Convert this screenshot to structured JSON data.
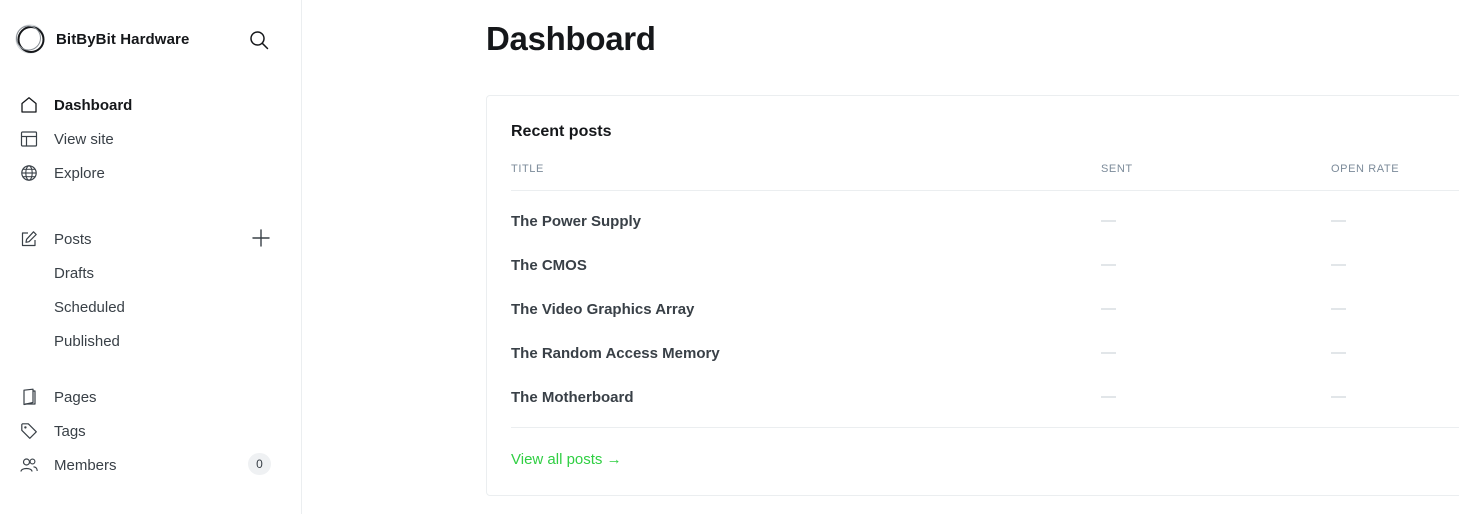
{
  "brand": {
    "name": "BitByBit Hardware"
  },
  "nav": {
    "primary": [
      {
        "label": "Dashboard",
        "icon": "home-icon"
      },
      {
        "label": "View site",
        "icon": "layout-icon"
      },
      {
        "label": "Explore",
        "icon": "globe-icon"
      }
    ],
    "posts": {
      "label": "Posts",
      "icon": "pencil-icon",
      "subitems": [
        "Drafts",
        "Scheduled",
        "Published"
      ]
    },
    "secondary": [
      {
        "label": "Pages",
        "icon": "pages-icon"
      },
      {
        "label": "Tags",
        "icon": "tag-icon"
      },
      {
        "label": "Members",
        "icon": "members-icon",
        "count": "0"
      }
    ]
  },
  "main": {
    "title": "Dashboard",
    "recent_posts": {
      "title": "Recent posts",
      "columns": [
        "TITLE",
        "SENT",
        "OPEN RATE"
      ],
      "rows": [
        {
          "title": "The Power Supply",
          "sent": "—",
          "open_rate": "—"
        },
        {
          "title": "The CMOS",
          "sent": "—",
          "open_rate": "—"
        },
        {
          "title": "The Video Graphics Array",
          "sent": "—",
          "open_rate": "—"
        },
        {
          "title": "The Random Access Memory",
          "sent": "—",
          "open_rate": "—"
        },
        {
          "title": "The Motherboard",
          "sent": "—",
          "open_rate": "—"
        }
      ],
      "view_all": "View all posts →"
    }
  },
  "colors": {
    "accent": "#30cf43",
    "text": "#15171a",
    "muted": "#7c8b9a",
    "border": "#ebeef0"
  }
}
